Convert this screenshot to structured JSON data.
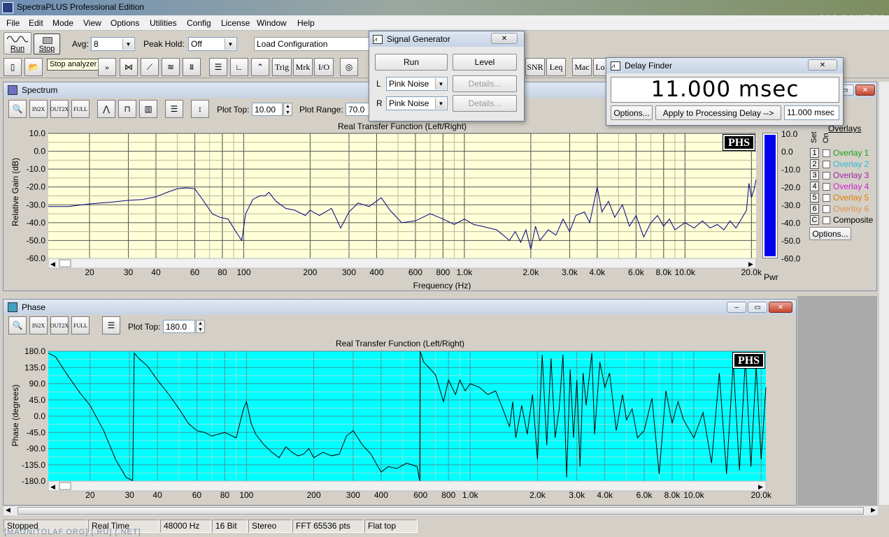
{
  "app": {
    "title": "SpectraPLUS Professional Edition",
    "watermark": "MAGNITOLA",
    "watermark_sub": "Autosound Team"
  },
  "menu": [
    "File",
    "Edit",
    "Mode",
    "View",
    "Options",
    "Utilities",
    "Config",
    "License",
    "Window",
    "Help"
  ],
  "toolbar": {
    "run_label": "Run",
    "stop_label": "Stop",
    "avg_label": "Avg:",
    "avg_value": "8",
    "peak_label": "Peak Hold:",
    "peak_value": "Off",
    "config_value": "Load Configuration",
    "tooltip": "Stop analyzer",
    "buttons": [
      "Trig",
      "Mrk",
      "I/O"
    ],
    "buttons2": [
      "SNR",
      "Leq",
      "Mac",
      "Lo"
    ]
  },
  "signal_gen": {
    "title": "Signal Generator",
    "run": "Run",
    "level": "Level",
    "l": "L",
    "r": "R",
    "l_value": "Pink Noise",
    "r_value": "Pink Noise",
    "details": "Details..."
  },
  "delay": {
    "title": "Delay Finder",
    "value": "11.000 msec",
    "options": "Options...",
    "apply": "Apply to Processing Delay -->",
    "field": "11.000 msec"
  },
  "spectrum": {
    "title": "Spectrum",
    "plot_top_label": "Plot Top:",
    "plot_top": "10.00",
    "plot_range_label": "Plot Range:",
    "plot_range": "70.0",
    "chart_title": "Real Transfer Function (Left/Right)",
    "ylabel": "Relative Gain (dB)",
    "xlabel": "Frequency (Hz)",
    "pwr": "Pwr",
    "logo": "PHS",
    "overlays_title": "Overlays",
    "set": "Set",
    "on": "On",
    "overlays": [
      {
        "n": "1",
        "label": "Overlay 1",
        "color": "#1aa01a"
      },
      {
        "n": "2",
        "label": "Overlay 2",
        "color": "#2cb8d0"
      },
      {
        "n": "3",
        "label": "Overlay 3",
        "color": "#a020a0"
      },
      {
        "n": "4",
        "label": "Overlay 4",
        "color": "#d020d0"
      },
      {
        "n": "5",
        "label": "Overlay 5",
        "color": "#e08000"
      },
      {
        "n": "6",
        "label": "Overlay 6",
        "color": "#e09050"
      },
      {
        "n": "C",
        "label": "Composite",
        "color": "#000000"
      }
    ],
    "options": "Options..."
  },
  "phase": {
    "title": "Phase",
    "plot_top_label": "Plot Top:",
    "plot_top": "180.0",
    "chart_title": "Real Transfer Function (Left/Right)",
    "ylabel": "Phase (degrees)",
    "logo": "PHS"
  },
  "status": [
    "Stopped",
    "Real Time",
    "48000 Hz",
    "16 Bit",
    "Stereo",
    "FFT 65536 pts",
    "Flat top"
  ],
  "status_url": "[MAGNITOLAF.ORG] [.RU] [.NET]",
  "chart_data": [
    {
      "type": "line",
      "title": "Real Transfer Function (Left/Right)",
      "xlabel": "Frequency (Hz)",
      "ylabel": "Relative Gain (dB)",
      "xscale": "log",
      "xlim": [
        13,
        21000
      ],
      "ylim": [
        -60,
        10
      ],
      "yticks": [
        "10.0",
        "0.0",
        "-10.0",
        "-20.0",
        "-30.0",
        "-40.0",
        "-50.0",
        "-60.0"
      ],
      "xticks": [
        [
          20,
          "20"
        ],
        [
          30,
          "30"
        ],
        [
          40,
          "40"
        ],
        [
          60,
          "60"
        ],
        [
          80,
          "80"
        ],
        [
          100,
          "100"
        ],
        [
          200,
          "200"
        ],
        [
          300,
          "300"
        ],
        [
          400,
          "400"
        ],
        [
          600,
          "600"
        ],
        [
          800,
          "800"
        ],
        [
          1000,
          "1.0k"
        ],
        [
          2000,
          "2.0k"
        ],
        [
          3000,
          "3.0k"
        ],
        [
          4000,
          "4.0k"
        ],
        [
          6000,
          "6.0k"
        ],
        [
          8000,
          "8.0k"
        ],
        [
          10000,
          "10.0k"
        ],
        [
          20000,
          "20.0k"
        ]
      ],
      "series": [
        {
          "color": "#000080",
          "points": [
            [
              13,
              -31
            ],
            [
              16,
              -31
            ],
            [
              20,
              -29.5
            ],
            [
              25,
              -28.5
            ],
            [
              30,
              -27.5
            ],
            [
              35,
              -27
            ],
            [
              40,
              -25.5
            ],
            [
              45,
              -23
            ],
            [
              50,
              -21
            ],
            [
              55,
              -20.5
            ],
            [
              60,
              -21
            ],
            [
              65,
              -27
            ],
            [
              72,
              -35
            ],
            [
              78,
              -37
            ],
            [
              85,
              -38
            ],
            [
              92,
              -45
            ],
            [
              98,
              -50
            ],
            [
              102,
              -35
            ],
            [
              110,
              -27
            ],
            [
              118,
              -25
            ],
            [
              125,
              -25
            ],
            [
              130,
              -23
            ],
            [
              140,
              -28
            ],
            [
              155,
              -32
            ],
            [
              170,
              -33
            ],
            [
              190,
              -36
            ],
            [
              200,
              -33
            ],
            [
              220,
              -36
            ],
            [
              250,
              -32
            ],
            [
              275,
              -43
            ],
            [
              300,
              -34
            ],
            [
              330,
              -29
            ],
            [
              370,
              -31
            ],
            [
              420,
              -26
            ],
            [
              460,
              -33
            ],
            [
              520,
              -40
            ],
            [
              600,
              -39
            ],
            [
              700,
              -35
            ],
            [
              800,
              -38
            ],
            [
              900,
              -41
            ],
            [
              1000,
              -38
            ],
            [
              1100,
              -41
            ],
            [
              1200,
              -42
            ],
            [
              1400,
              -44
            ],
            [
              1500,
              -47
            ],
            [
              1600,
              -50
            ],
            [
              1700,
              -45
            ],
            [
              1800,
              -51
            ],
            [
              1900,
              -44
            ],
            [
              2000,
              -55
            ],
            [
              2100,
              -42
            ],
            [
              2200,
              -50
            ],
            [
              2400,
              -44
            ],
            [
              2600,
              -47
            ],
            [
              2800,
              -38
            ],
            [
              3000,
              -45
            ],
            [
              3200,
              -36
            ],
            [
              3500,
              -34
            ],
            [
              3700,
              -40
            ],
            [
              4000,
              -20
            ],
            [
              4200,
              -34
            ],
            [
              4500,
              -28
            ],
            [
              4800,
              -37
            ],
            [
              5200,
              -30
            ],
            [
              5600,
              -42
            ],
            [
              6000,
              -36
            ],
            [
              6500,
              -48
            ],
            [
              7000,
              -40
            ],
            [
              7500,
              -36
            ],
            [
              8000,
              -42
            ],
            [
              8500,
              -38
            ],
            [
              9000,
              -44
            ],
            [
              10000,
              -40
            ],
            [
              11000,
              -43
            ],
            [
              12000,
              -39
            ],
            [
              13000,
              -43
            ],
            [
              14000,
              -41
            ],
            [
              15000,
              -44
            ],
            [
              16000,
              -39
            ],
            [
              17000,
              -43
            ],
            [
              18000,
              -38
            ],
            [
              19000,
              -33
            ],
            [
              19500,
              -18
            ],
            [
              20000,
              -26
            ],
            [
              20500,
              -22
            ],
            [
              21000,
              -16
            ]
          ]
        }
      ]
    },
    {
      "type": "line",
      "title": "Real Transfer Function (Left/Right)",
      "ylabel": "Phase (degrees)",
      "xscale": "log",
      "xlim": [
        13,
        21000
      ],
      "ylim": [
        -180,
        180
      ],
      "yticks": [
        "180.0",
        "135.0",
        "90.0",
        "45.0",
        "0.0",
        "-45.0",
        "-90.0",
        "-135.0",
        "-180.0"
      ],
      "xticks": [
        [
          20,
          "20"
        ],
        [
          30,
          "30"
        ],
        [
          40,
          "40"
        ],
        [
          60,
          "60"
        ],
        [
          80,
          "80"
        ],
        [
          100,
          "100"
        ],
        [
          200,
          "200"
        ],
        [
          300,
          "300"
        ],
        [
          400,
          "400"
        ],
        [
          600,
          "600"
        ],
        [
          800,
          "800"
        ],
        [
          1000,
          "1.0k"
        ],
        [
          2000,
          "2.0k"
        ],
        [
          3000,
          "3.0k"
        ],
        [
          4000,
          "4.0k"
        ],
        [
          6000,
          "6.0k"
        ],
        [
          8000,
          "8.0k"
        ],
        [
          10000,
          "10.0k"
        ],
        [
          20000,
          "20.0k"
        ]
      ],
      "series": [
        {
          "color": "#000000",
          "points": [
            [
              13,
              175
            ],
            [
              14,
              165
            ],
            [
              16,
              110
            ],
            [
              18,
              65
            ],
            [
              20,
              30
            ],
            [
              23,
              -40
            ],
            [
              26,
              -120
            ],
            [
              29,
              -170
            ],
            [
              31,
              -178
            ],
            [
              31.5,
              175
            ],
            [
              33,
              160
            ],
            [
              36,
              140
            ],
            [
              40,
              100
            ],
            [
              45,
              60
            ],
            [
              50,
              20
            ],
            [
              55,
              -20
            ],
            [
              60,
              -40
            ],
            [
              65,
              -45
            ],
            [
              70,
              -55
            ],
            [
              80,
              -45
            ],
            [
              90,
              -60
            ],
            [
              97,
              20
            ],
            [
              100,
              40
            ],
            [
              105,
              -20
            ],
            [
              110,
              -50
            ],
            [
              120,
              -80
            ],
            [
              130,
              -100
            ],
            [
              140,
              -115
            ],
            [
              150,
              -85
            ],
            [
              160,
              -100
            ],
            [
              170,
              -110
            ],
            [
              180,
              -105
            ],
            [
              190,
              -90
            ],
            [
              200,
              -115
            ],
            [
              220,
              -100
            ],
            [
              240,
              -110
            ],
            [
              260,
              -105
            ],
            [
              280,
              -55
            ],
            [
              300,
              -40
            ],
            [
              330,
              -80
            ],
            [
              360,
              -105
            ],
            [
              400,
              -155
            ],
            [
              430,
              -140
            ],
            [
              470,
              -145
            ],
            [
              520,
              -130
            ],
            [
              580,
              -140
            ],
            [
              595,
              -180
            ],
            [
              598,
              180
            ],
            [
              620,
              150
            ],
            [
              700,
              115
            ],
            [
              760,
              40
            ],
            [
              800,
              100
            ],
            [
              860,
              60
            ],
            [
              900,
              100
            ],
            [
              950,
              70
            ],
            [
              1000,
              90
            ],
            [
              1100,
              80
            ],
            [
              1200,
              60
            ],
            [
              1300,
              70
            ],
            [
              1400,
              20
            ],
            [
              1500,
              -30
            ],
            [
              1550,
              40
            ],
            [
              1600,
              -60
            ],
            [
              1700,
              30
            ],
            [
              1800,
              -50
            ],
            [
              1900,
              60
            ],
            [
              2000,
              -120
            ],
            [
              2100,
              170
            ],
            [
              2200,
              -80
            ],
            [
              2300,
              160
            ],
            [
              2400,
              -60
            ],
            [
              2500,
              20
            ],
            [
              2600,
              170
            ],
            [
              2700,
              -170
            ],
            [
              2800,
              130
            ],
            [
              2900,
              -60
            ],
            [
              3000,
              100
            ],
            [
              3100,
              -140
            ],
            [
              3200,
              120
            ],
            [
              3300,
              30
            ],
            [
              3500,
              175
            ],
            [
              3600,
              -50
            ],
            [
              3800,
              150
            ],
            [
              4000,
              80
            ],
            [
              4200,
              120
            ],
            [
              4500,
              -40
            ],
            [
              4800,
              60
            ],
            [
              5000,
              -10
            ],
            [
              5300,
              20
            ],
            [
              5600,
              -60
            ],
            [
              6000,
              -40
            ],
            [
              6500,
              50
            ],
            [
              7000,
              -160
            ],
            [
              7500,
              70
            ],
            [
              8000,
              -20
            ],
            [
              8500,
              40
            ],
            [
              9000,
              -10
            ],
            [
              10000,
              -60
            ],
            [
              11000,
              10
            ],
            [
              12000,
              -130
            ],
            [
              13000,
              120
            ],
            [
              14000,
              -160
            ],
            [
              15000,
              150
            ],
            [
              16000,
              -150
            ],
            [
              17000,
              160
            ],
            [
              18000,
              -140
            ],
            [
              19000,
              140
            ],
            [
              20000,
              -120
            ],
            [
              21000,
              80
            ]
          ]
        }
      ]
    }
  ]
}
